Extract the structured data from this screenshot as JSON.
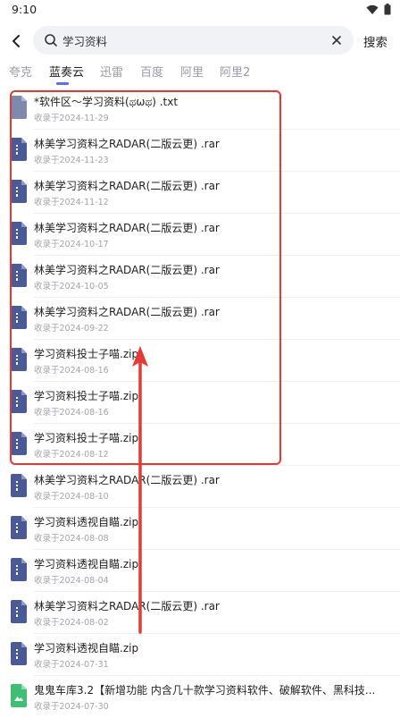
{
  "status_bar": {
    "time": "9:10"
  },
  "search": {
    "query": "学习资料",
    "button_label": "搜索"
  },
  "tabs": [
    {
      "label": "夸克",
      "active": false
    },
    {
      "label": "蓝奏云",
      "active": true
    },
    {
      "label": "迅雷",
      "active": false
    },
    {
      "label": "百度",
      "active": false
    },
    {
      "label": "阿里",
      "active": false
    },
    {
      "label": "阿里2",
      "active": false
    }
  ],
  "files": [
    {
      "name": "*软件区～学习资料(ಥωಥ) .txt",
      "date": "收录于2024-11-29",
      "icon": "txt-file-icon"
    },
    {
      "name": "林美学习资料之RADAR(二版云更) .rar",
      "date": "收录于2024-11-23",
      "icon": "archive-file-icon"
    },
    {
      "name": "林美学习资料之RADAR(二版云更) .rar",
      "date": "收录于2024-11-12",
      "icon": "archive-file-icon"
    },
    {
      "name": "林美学习资料之RADAR(二版云更) .rar",
      "date": "收录于2024-10-17",
      "icon": "archive-file-icon"
    },
    {
      "name": "林美学习资料之RADAR(二版云更) .rar",
      "date": "收录于2024-10-05",
      "icon": "archive-file-icon"
    },
    {
      "name": "林美学习资料之RADAR(二版云更) .rar",
      "date": "收录于2024-09-22",
      "icon": "archive-file-icon"
    },
    {
      "name": "学习资料投士子喵.zip",
      "date": "收录于2024-08-16",
      "icon": "archive-file-icon"
    },
    {
      "name": "学习资料投士子喵.zip",
      "date": "收录于2024-08-16",
      "icon": "archive-file-icon"
    },
    {
      "name": "学习资料投士子喵.zip",
      "date": "收录于2024-08-12",
      "icon": "archive-file-icon"
    },
    {
      "name": "林美学习资料之RADAR(二版云更) .rar",
      "date": "收录于2024-08-10",
      "icon": "archive-file-icon"
    },
    {
      "name": "学习资料透视自瞄.zip",
      "date": "收录于2024-08-08",
      "icon": "archive-file-icon"
    },
    {
      "name": "学习资料透视自瞄.zip",
      "date": "收录于2024-08-04",
      "icon": "archive-file-icon"
    },
    {
      "name": "林美学习资料之RADAR(二版云更) .rar",
      "date": "收录于2024-08-02",
      "icon": "archive-file-icon"
    },
    {
      "name": "学习资料透视自瞄.zip",
      "date": "收录于2024-07-31",
      "icon": "archive-file-icon"
    },
    {
      "name": "鬼鬼车库3.2【新增功能 内含几十款学习资料软件、破解软件、黑科技...",
      "date": "收录于2024-07-30",
      "icon": "apk-file-icon"
    }
  ],
  "colors": {
    "accent": "#5b6bff",
    "file_icon": "#4a5a96",
    "txt_icon": "#7f88ad",
    "apk_icon": "#3fbf74",
    "annotation": "#e53935"
  }
}
